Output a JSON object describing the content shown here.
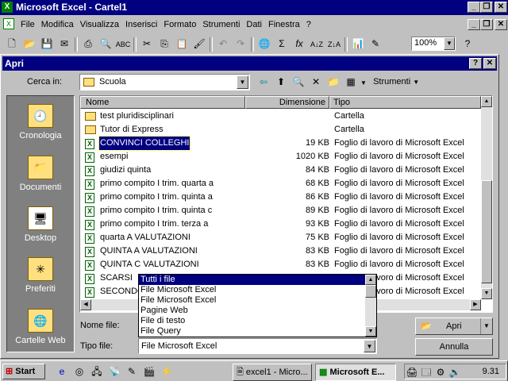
{
  "app": {
    "title": "Microsoft Excel - Cartel1"
  },
  "menubar": {
    "items": [
      "File",
      "Modifica",
      "Visualizza",
      "Inserisci",
      "Formato",
      "Strumenti",
      "Dati",
      "Finestra",
      "?"
    ]
  },
  "toolbar": {
    "zoom": "100%"
  },
  "dialog": {
    "title": "Apri",
    "lookin_label": "Cerca in:",
    "lookin_value": "Scuola",
    "tools_label": "Strumenti",
    "places": [
      "Cronologia",
      "Documenti",
      "Desktop",
      "Preferiti",
      "Cartelle Web"
    ],
    "columns": {
      "name": "Nome",
      "size": "Dimensione",
      "type": "Tipo"
    },
    "files": [
      {
        "name": "test pluridisciplinari",
        "size": "",
        "type": "Cartella",
        "kind": "folder"
      },
      {
        "name": "Tutor di Express",
        "size": "",
        "type": "Cartella",
        "kind": "folder"
      },
      {
        "name": "CONVINCI COLLEGHI",
        "size": "19 KB",
        "type": "Foglio di lavoro di Microsoft Excel",
        "kind": "xls",
        "selected": true
      },
      {
        "name": "esempi",
        "size": "1020 KB",
        "type": "Foglio di lavoro di Microsoft Excel",
        "kind": "xls"
      },
      {
        "name": "giudizi quinta",
        "size": "84 KB",
        "type": "Foglio di lavoro di Microsoft Excel",
        "kind": "xls"
      },
      {
        "name": "primo compito I trim. quarta a",
        "size": "68 KB",
        "type": "Foglio di lavoro di Microsoft Excel",
        "kind": "xls"
      },
      {
        "name": "primo compito I trim. quinta a",
        "size": "86 KB",
        "type": "Foglio di lavoro di Microsoft Excel",
        "kind": "xls"
      },
      {
        "name": "primo compito I trim. quinta c",
        "size": "89 KB",
        "type": "Foglio di lavoro di Microsoft Excel",
        "kind": "xls"
      },
      {
        "name": "primo compito I trim. terza a",
        "size": "93 KB",
        "type": "Foglio di lavoro di Microsoft Excel",
        "kind": "xls"
      },
      {
        "name": "quarta A VALUTAZIONI",
        "size": "75 KB",
        "type": "Foglio di lavoro di Microsoft Excel",
        "kind": "xls"
      },
      {
        "name": "QUINTA A VALUTAZIONI",
        "size": "83 KB",
        "type": "Foglio di lavoro di Microsoft Excel",
        "kind": "xls"
      },
      {
        "name": "QUINTA C VALUTAZIONI",
        "size": "83 KB",
        "type": "Foglio di lavoro di Microsoft Excel",
        "kind": "xls"
      },
      {
        "name": "SCARSI",
        "size": "",
        "type": "Foglio di lavoro di Microsoft Excel",
        "kind": "xls"
      },
      {
        "name": "SECONDO",
        "size": "",
        "type": "Foglio di lavoro di Microsoft Excel",
        "kind": "xls"
      }
    ],
    "filename_label": "Nome file:",
    "filetype_label": "Tipo file:",
    "filetype_value": "File Microsoft Excel",
    "filetype_options": [
      "Tutti i file",
      "File Microsoft Excel",
      "File Microsoft Excel",
      "Pagine Web",
      "File di testo",
      "File Query"
    ],
    "open_button": "Apri",
    "cancel_button": "Annulla"
  },
  "taskbar": {
    "start": "Start",
    "tasks": [
      "excel1 - Micro...",
      "Microsoft E..."
    ],
    "clock": "9.31"
  }
}
